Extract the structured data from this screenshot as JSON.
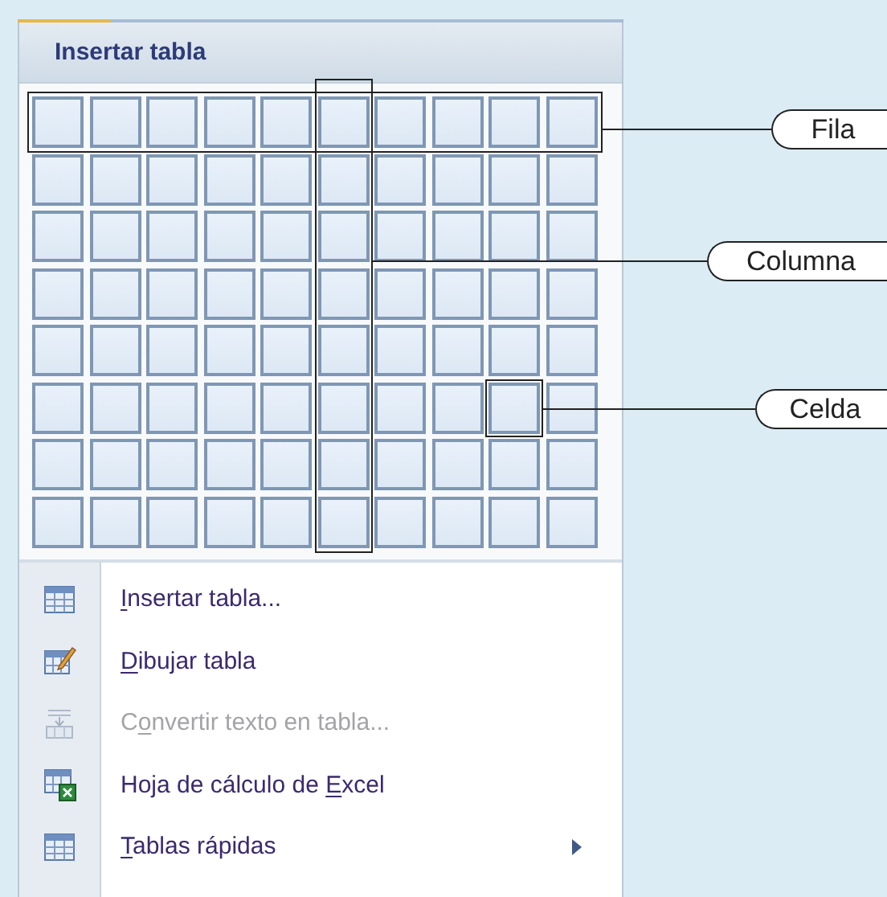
{
  "menu": {
    "title": "Insertar tabla",
    "items": [
      {
        "kind": "table",
        "segments": [
          {
            "text": "I",
            "access_key": true
          },
          {
            "text": "nsertar tabla...",
            "access_key": false
          }
        ],
        "disabled": false,
        "submenu": false
      },
      {
        "kind": "draw-table",
        "segments": [
          {
            "text": "D",
            "access_key": true
          },
          {
            "text": "ibujar tabla",
            "access_key": false
          }
        ],
        "disabled": false,
        "submenu": false
      },
      {
        "kind": "convert",
        "segments": [
          {
            "text": "C",
            "access_key": false
          },
          {
            "text": "o",
            "access_key": true
          },
          {
            "text": "nvertir texto en tabla...",
            "access_key": false
          }
        ],
        "disabled": true,
        "submenu": false
      },
      {
        "kind": "spreadsheet",
        "segments": [
          {
            "text": "Hoja de cálculo de ",
            "access_key": false
          },
          {
            "text": "E",
            "access_key": true
          },
          {
            "text": "xcel",
            "access_key": false
          }
        ],
        "disabled": false,
        "submenu": false
      },
      {
        "kind": "table",
        "segments": [
          {
            "text": "T",
            "access_key": true
          },
          {
            "text": "ablas rápidas",
            "access_key": false
          }
        ],
        "disabled": false,
        "submenu": true
      }
    ]
  },
  "callouts": [
    {
      "kind": "row",
      "label": "Fila"
    },
    {
      "kind": "column",
      "label": "Columna"
    },
    {
      "kind": "cell",
      "label": "Celda"
    }
  ]
}
